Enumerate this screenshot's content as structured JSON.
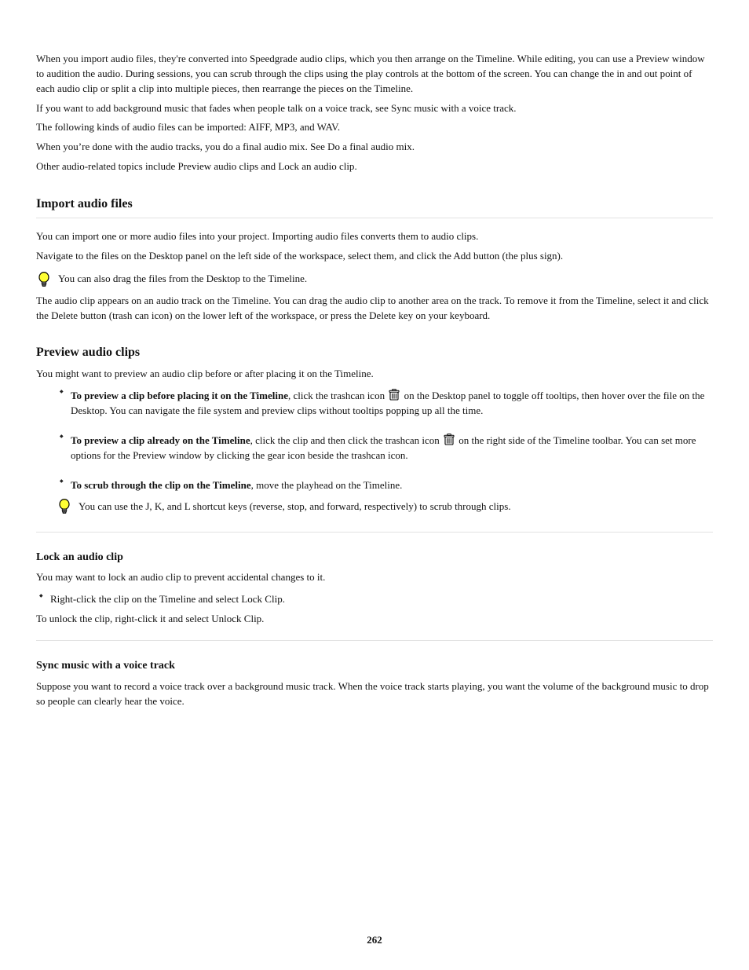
{
  "intro": {
    "p1": "When you import audio files, they're converted into Speedgrade audio clips, which you then arrange on the Timeline. While editing, you can use a Preview window to audition the audio. During sessions, you can scrub through the clips using the play controls at the bottom of the screen. You can change the in and out point of each audio clip or split a clip into multiple pieces, then rearrange the pieces on the Timeline.",
    "p2_a": "If you want to add background music that fades when people talk on a voice track, see ",
    "p2_link": "Sync music with a voice track",
    "p2_b": ".",
    "p3": "The following kinds of audio files can be imported: AIFF, MP3, and WAV.",
    "p4_a": "When you’re done with the audio tracks, you do a final audio mix. See ",
    "p4_link": "Do a final audio mix",
    "p4_b": ".",
    "p5_a": "Other audio-related topics include ",
    "p5_link1": "Preview audio clips",
    "p5_c": " and ",
    "p5_link2": "Lock an audio clip",
    "p5_d": "."
  },
  "import": {
    "heading": "Import audio files",
    "p1": "You can import one or more audio files into your project. Importing audio files converts them to audio clips.",
    "p2": "Navigate to the files on the Desktop panel on the left side of the workspace, select them, and click the Add button (the plus sign).",
    "tip": "You can also drag the files from the Desktop to the Timeline.",
    "p3": "The audio clip appears on an audio track on the Timeline. You can drag the audio clip to another area on the track. To remove it from the Timeline, select it and click the Delete button (trash can icon) on the lower left of the workspace, or press the Delete key on your keyboard."
  },
  "preview": {
    "heading": "Preview audio clips",
    "p1": "You might want to preview an audio clip before or after placing it on the Timeline.",
    "bullets": [
      {
        "main": "To preview a clip before placing it on the Timeline",
        "rest": ", click the trashcan icon ",
        "after_icon": " on the Desktop panel to toggle off tooltips, then hover over the file on the Desktop. You can navigate the file system and preview clips without tooltips popping up all the time."
      },
      {
        "main": "To preview a clip already on the Timeline",
        "rest": ", click the clip and then click the trashcan icon ",
        "after_icon": " on the right side of the Timeline toolbar. You can set more options for the Preview window by clicking the gear icon beside the trashcan icon."
      },
      {
        "main": "To scrub through the clip on the Timeline",
        "rest": ", move the playhead on the Timeline.",
        "tip": "You can use the J, K, and L shortcut keys (reverse, stop, and forward, respectively) to scrub through clips."
      }
    ]
  },
  "lock": {
    "heading": "Lock an audio clip",
    "p1": "You may want to lock an audio clip to prevent accidental changes to it.",
    "bullet": "Right-click the clip on the Timeline and select Lock Clip.",
    "p2": "To unlock the clip, right-click it and select Unlock Clip."
  },
  "outro": {
    "heading": "Sync music with a voice track",
    "p": "Suppose you want to record a voice track over a background music track. When the voice track starts playing, you want the volume of the background music to drop so people can clearly hear the voice."
  },
  "page_number": "262"
}
